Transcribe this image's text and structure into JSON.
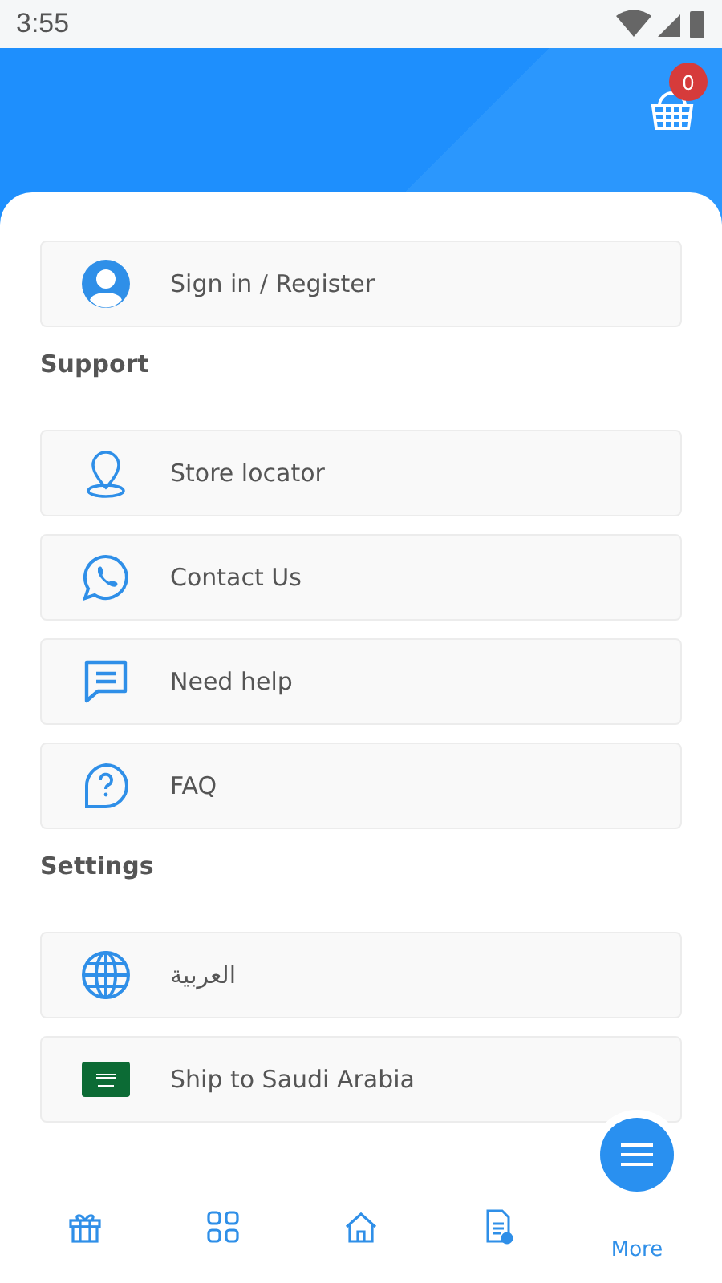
{
  "status_bar": {
    "time": "3:55"
  },
  "header": {
    "cart_count": "0"
  },
  "account": {
    "kind": "user",
    "label": "Sign in / Register"
  },
  "sections": [
    {
      "title": "Support",
      "items": [
        {
          "kind": "pin",
          "label": "Store locator"
        },
        {
          "kind": "whatsapp",
          "label": "Contact Us"
        },
        {
          "kind": "chat",
          "label": "Need help"
        },
        {
          "kind": "question",
          "label": "FAQ"
        }
      ]
    },
    {
      "title": "Settings",
      "items": [
        {
          "kind": "globe",
          "label": "العربية"
        },
        {
          "kind": "flag",
          "label": "Ship to Saudi Arabia"
        }
      ]
    }
  ],
  "bottom_nav": [
    {
      "kind": "gift",
      "selected": false
    },
    {
      "kind": "grid",
      "selected": false
    },
    {
      "kind": "home",
      "selected": false
    },
    {
      "kind": "document",
      "selected": false
    },
    {
      "kind": "menu",
      "label": "More",
      "selected": true
    }
  ]
}
